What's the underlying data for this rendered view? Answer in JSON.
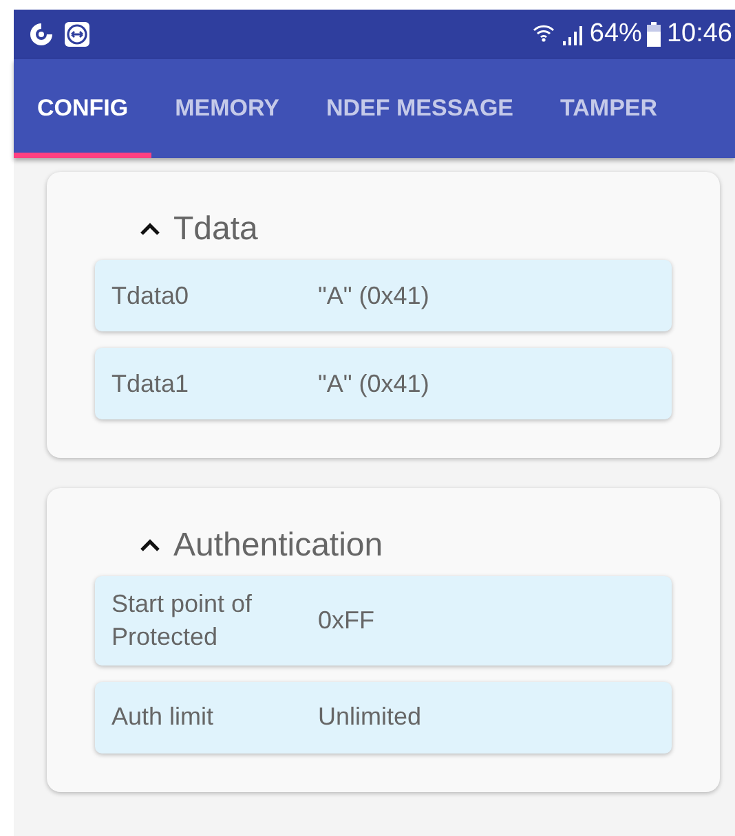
{
  "status_bar": {
    "battery": "64%",
    "time": "10:46"
  },
  "tabs": [
    {
      "label": "CONFIG",
      "selected": true
    },
    {
      "label": "MEMORY",
      "selected": false
    },
    {
      "label": "NDEF MESSAGE",
      "selected": false
    },
    {
      "label": "TAMPER",
      "selected": false
    }
  ],
  "sections": [
    {
      "title": "Tdata",
      "expanded": true,
      "rows": [
        {
          "label": "Tdata0",
          "value": "\"A\"  (0x41)"
        },
        {
          "label": "Tdata1",
          "value": "\"A\"  (0x41)"
        }
      ]
    },
    {
      "title": "Authentication",
      "expanded": true,
      "rows": [
        {
          "label": "Start point of Protected",
          "value": "0xFF"
        },
        {
          "label": "Auth limit",
          "value": "Unlimited"
        }
      ]
    }
  ]
}
